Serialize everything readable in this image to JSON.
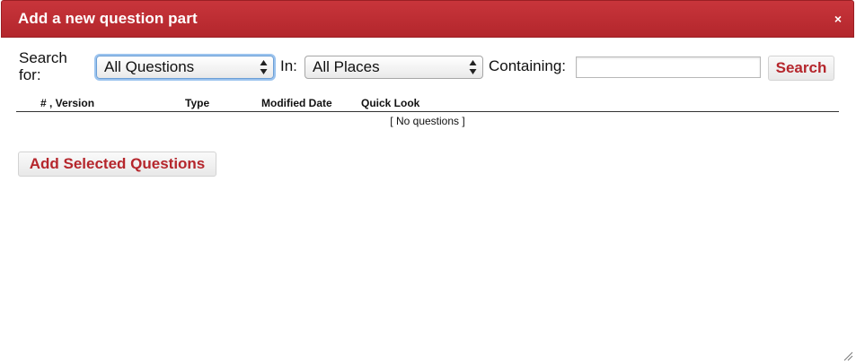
{
  "dialog": {
    "title": "Add a new question part",
    "close_glyph": "×"
  },
  "search": {
    "search_for_label": "Search for:",
    "type_select": {
      "value": "All Questions"
    },
    "in_label": "In:",
    "place_select": {
      "value": "All Places"
    },
    "containing_label": "Containing:",
    "query": {
      "value": "",
      "placeholder": ""
    },
    "search_button_label": "Search"
  },
  "table": {
    "columns": [
      "# , Version",
      "Type",
      "Modified Date",
      "Quick Look"
    ],
    "empty_message": "[ No questions ]"
  },
  "actions": {
    "add_selected_label": "Add Selected Questions"
  },
  "icons": {
    "close": "close-icon",
    "select_arrows": "select-arrows-icon",
    "resize": "resize-grip-icon"
  },
  "colors": {
    "titlebar": "#b3262c",
    "button_text": "#b5262c",
    "focus_ring": "#9bc3ee"
  }
}
